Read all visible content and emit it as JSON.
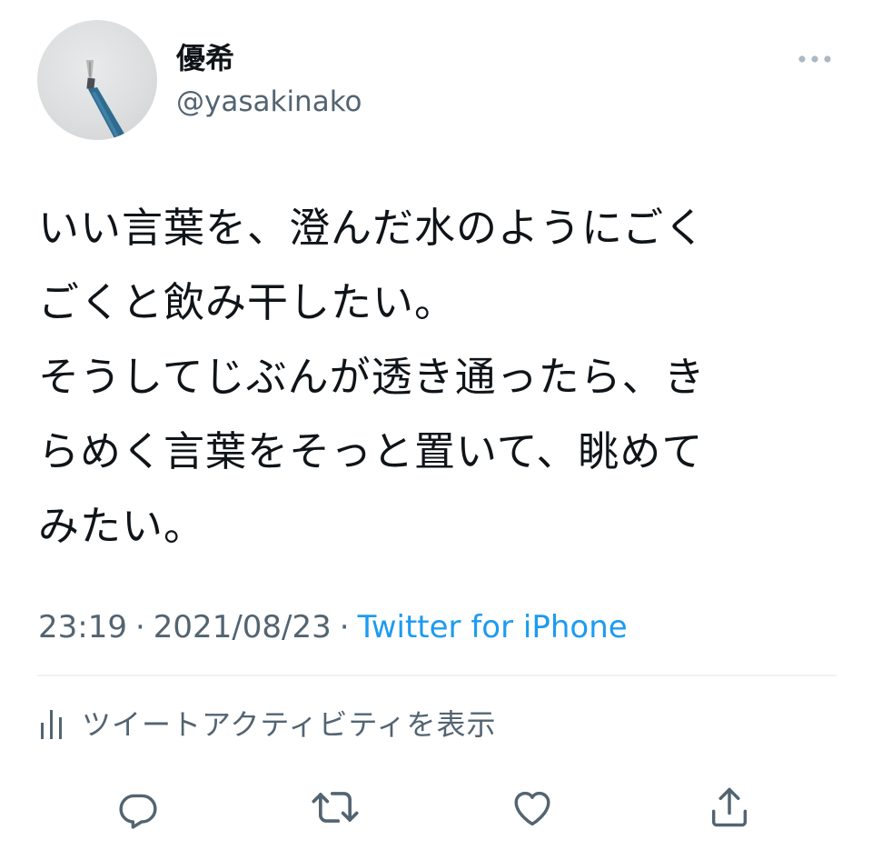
{
  "user": {
    "display_name": "優希",
    "handle": "@yasakinako",
    "avatar_icon": "fountain-pen-avatar"
  },
  "tweet": {
    "lines": [
      "いい言葉を、澄んだ水のようにごく",
      "ごくと飲み干したい。",
      "そうしてじぶんが透き通ったら、き",
      "らめく言葉をそっと置いて、眺めて",
      "みたい。"
    ]
  },
  "meta": {
    "time": "23:19",
    "separator": "·",
    "date": "2021/08/23",
    "source": "Twitter for iPhone"
  },
  "activity": {
    "label": "ツイートアクティビティを表示",
    "icon": "bar-chart-icon"
  },
  "actions": {
    "reply_icon": "reply-icon",
    "retweet_icon": "retweet-icon",
    "like_icon": "heart-icon",
    "share_icon": "share-icon"
  },
  "colors": {
    "text_primary": "#0f1419",
    "text_secondary": "#536471",
    "link": "#1d9bf0",
    "divider": "#eff3f4"
  }
}
